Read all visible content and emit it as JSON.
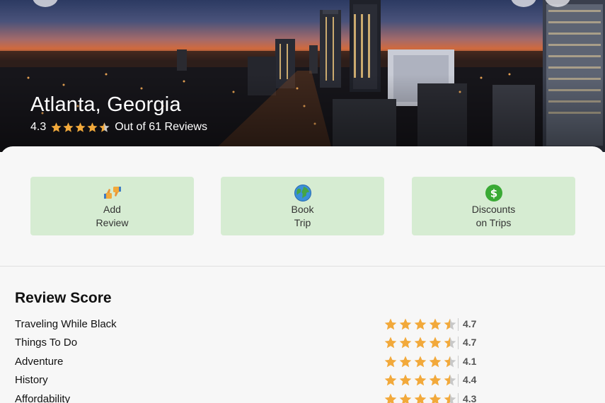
{
  "hero": {
    "title": "Atlanta, Georgia",
    "rating": "4.3",
    "rating_stars": 4.3,
    "reviews_text": "Out of 61 Reviews"
  },
  "actions": [
    {
      "label_line1": "Add",
      "label_line2": "Review",
      "icon": "thumbs-up-down-icon"
    },
    {
      "label_line1": "Book",
      "label_line2": "Trip",
      "icon": "globe-icon"
    },
    {
      "label_line1": "Discounts",
      "label_line2": "on Trips",
      "icon": "dollar-coin-icon"
    }
  ],
  "review_score": {
    "title": "Review Score",
    "rows": [
      {
        "label": "Traveling While Black",
        "value": "4.7",
        "stars": 4.7
      },
      {
        "label": "Things To Do",
        "value": "4.7",
        "stars": 4.7
      },
      {
        "label": "Adventure",
        "value": "4.1",
        "stars": 4.1
      },
      {
        "label": "History",
        "value": "4.4",
        "stars": 4.4
      },
      {
        "label": "Affordability",
        "value": "4.3",
        "stars": 4.3
      }
    ]
  },
  "colors": {
    "star_filled": "#f2a93b",
    "star_empty": "#c8c8c8",
    "action_bg": "#d6ecd2"
  }
}
